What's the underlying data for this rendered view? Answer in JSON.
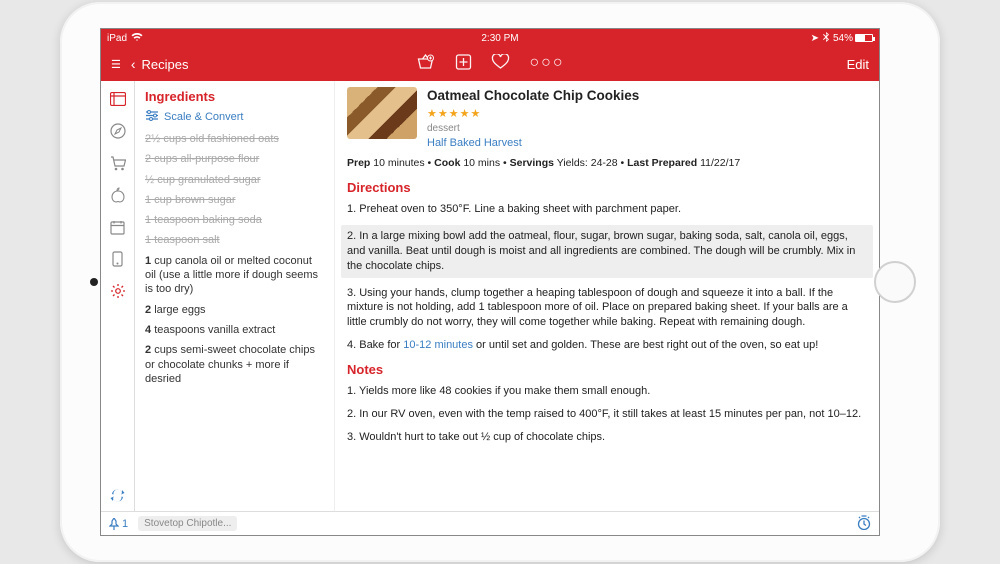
{
  "status": {
    "carrier": "iPad",
    "time": "2:30 PM",
    "battery_pct": "54%"
  },
  "nav": {
    "menu": "☰",
    "back_chevron": "‹",
    "back_label": "Recipes",
    "edit": "Edit"
  },
  "sidebar": {
    "items": [
      {
        "name": "browser",
        "active": true
      },
      {
        "name": "compass"
      },
      {
        "name": "cart"
      },
      {
        "name": "apple"
      },
      {
        "name": "calendar"
      },
      {
        "name": "phone"
      },
      {
        "name": "settings"
      }
    ]
  },
  "ingredients": {
    "heading": "Ingredients",
    "scale_label": "Scale & Convert",
    "list": [
      {
        "struck": true,
        "text": "2½ cups old fashioned oats"
      },
      {
        "struck": true,
        "text": "2 cups all-purpose flour"
      },
      {
        "struck": true,
        "text": "½ cup granulated sugar"
      },
      {
        "struck": true,
        "text": "1 cup brown sugar"
      },
      {
        "struck": true,
        "text": "1 teaspoon baking soda"
      },
      {
        "struck": true,
        "text": "1 teaspoon salt"
      },
      {
        "struck": false,
        "amt": "1",
        "text": "cup canola oil or melted coconut oil (use a little more if dough seems is too dry)"
      },
      {
        "struck": false,
        "amt": "2",
        "text": "large eggs"
      },
      {
        "struck": false,
        "amt": "4",
        "text": "teaspoons vanilla extract"
      },
      {
        "struck": false,
        "amt": "2",
        "text": "cups semi-sweet chocolate chips or chocolate chunks + more if desried"
      }
    ]
  },
  "recipe": {
    "title": "Oatmeal Chocolate Chip Cookies",
    "stars": "★★★★★",
    "tag": "dessert",
    "source": "Half Baked Harvest",
    "meta": {
      "prep_label": "Prep",
      "prep_val": "10 minutes",
      "cook_label": "Cook",
      "cook_val": "10 mins",
      "serv_label": "Servings",
      "serv_val": "Yields: 24-28",
      "last_label": "Last Prepared",
      "last_val": "11/22/17"
    },
    "directions_heading": "Directions",
    "steps": [
      "1. Preheat oven to 350°F. Line a baking sheet with parchment paper.",
      "2. In a large mixing bowl add the oatmeal, flour, sugar, brown sugar, baking soda, salt, canola oil, eggs, and vanilla. Beat until dough is moist and all ingredients are combined. The dough will be crumbly. Mix in the chocolate chips.",
      "3. Using your hands, clump together a heaping tablespoon of dough and squeeze it into a ball. If the mixture is not holding, add 1 tablespoon more of oil. Place on prepared baking sheet. If your balls are a little crumbly do not worry, they will come together while baking. Repeat with remaining dough."
    ],
    "step4_pre": "4. Bake for ",
    "step4_link": "10-12 minutes",
    "step4_post": " or until set and golden. These are best right out of the oven, so eat up!",
    "notes_heading": "Notes",
    "notes": [
      "1. Yields more like 48 cookies if you make them small enough.",
      "2. In our RV oven, even with the temp raised to 400°F, it still takes at least 15 minutes per pan, not 10–12.",
      "3. Wouldn't hurt to take out ½ cup of chocolate chips."
    ]
  },
  "footer": {
    "pin_count": "1",
    "chip": "Stovetop Chipotle..."
  }
}
